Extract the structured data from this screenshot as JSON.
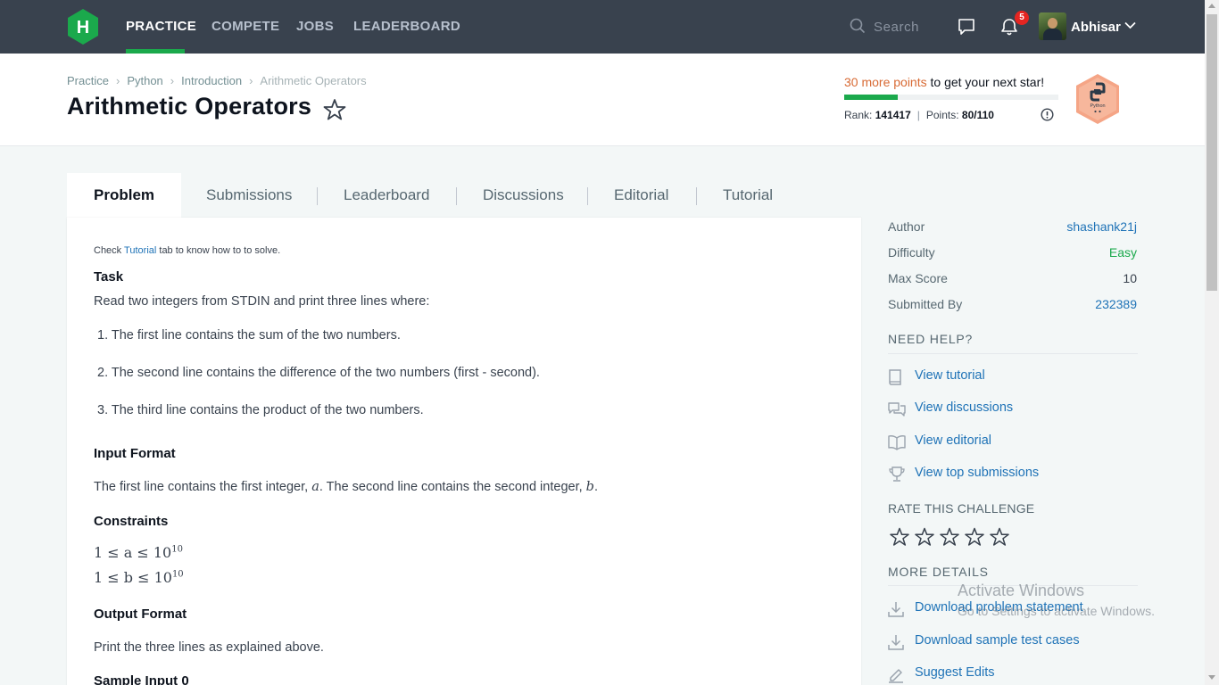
{
  "topnav": {
    "logo_letter": "H",
    "links": [
      "PRACTICE",
      "COMPETE",
      "JOBS",
      "LEADERBOARD"
    ],
    "search_placeholder": "Search",
    "notification_count": "5",
    "username": "Abhisar"
  },
  "breadcrumb": [
    "Practice",
    "Python",
    "Introduction",
    "Arithmetic Operators"
  ],
  "page_title": "Arithmetic Operators",
  "progress": {
    "points_highlight": "30 more points",
    "points_rest": " to get your next star!",
    "fill_fraction": 0.25,
    "rank_label": "Rank:",
    "rank_value": "141417",
    "points_label": "Points:",
    "points_value": "80/110",
    "badge_text": "Python"
  },
  "tabs": [
    "Problem",
    "Submissions",
    "Leaderboard",
    "Discussions",
    "Editorial",
    "Tutorial"
  ],
  "problem": {
    "note_prefix": "Check ",
    "note_link": "Tutorial",
    "note_suffix": " tab to know how to to solve.",
    "task_heading": "Task",
    "task_text": "Read two integers from STDIN and print three lines where:",
    "task_items": [
      "1. The first line contains the sum of the two numbers.",
      "2. The second line contains the difference of the two numbers (first - second).",
      "3. The third line contains the product of the two numbers."
    ],
    "input_heading": "Input Format",
    "input_text_1": "The first line contains the first integer, ",
    "input_var_a": "a",
    "input_text_2": ". The second line contains the second integer, ",
    "input_var_b": "b",
    "input_text_3": ".",
    "constraints_heading": "Constraints",
    "constraint_1": "1 ≤ a ≤ 10",
    "constraint_2": "1 ≤ b ≤ 10",
    "constraint_exponent": "10",
    "output_heading": "Output Format",
    "output_text": "Print the three lines as explained above.",
    "sample_heading": "Sample Input 0"
  },
  "sidebar": {
    "meta": [
      {
        "label": "Author",
        "value": "shashank21j"
      },
      {
        "label": "Difficulty",
        "value": "Easy"
      },
      {
        "label": "Max Score",
        "value": "10"
      },
      {
        "label": "Submitted By",
        "value": "232389"
      }
    ],
    "need_help_title": "NEED HELP?",
    "help_links": [
      "View tutorial",
      "View discussions",
      "View editorial",
      "View top submissions"
    ],
    "rate_title": "RATE THIS CHALLENGE",
    "more_details_title": "MORE DETAILS",
    "detail_links": [
      "Download problem statement",
      "Download sample test cases",
      "Suggest Edits"
    ]
  },
  "watermark": {
    "title": "Activate Windows",
    "subtitle": "Go to Settings to activate Windows."
  },
  "colors": {
    "nav_bg": "#39424e",
    "brand_green": "#1ba94c",
    "link_blue": "#1f73b7",
    "highlight_orange": "#d86a34",
    "badge_red": "#e52521"
  }
}
